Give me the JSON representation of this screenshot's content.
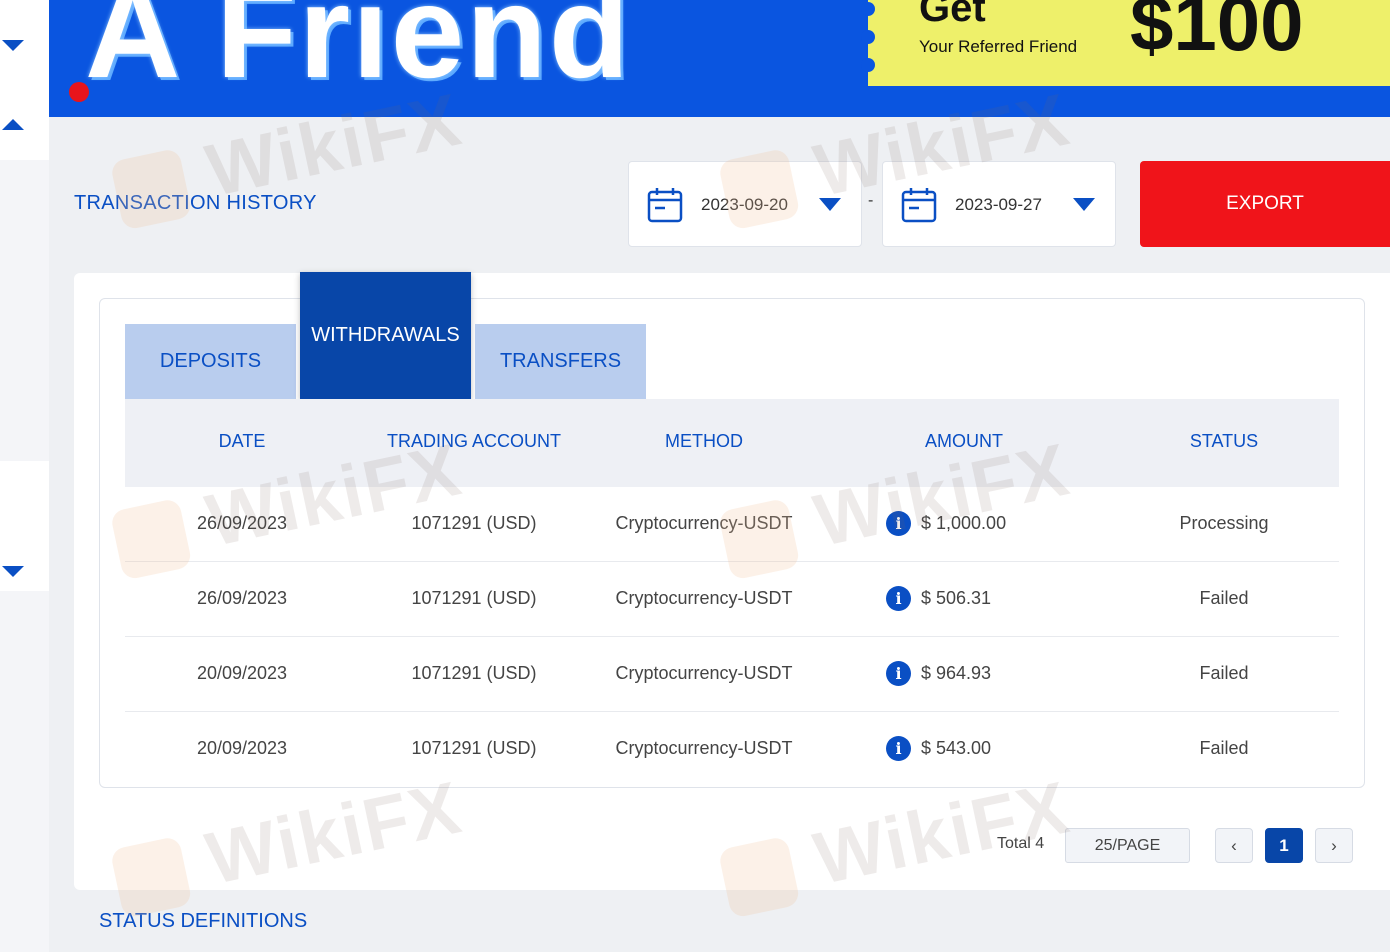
{
  "banner": {
    "title": "A Friend",
    "promo_get": "Get",
    "promo_sub": "Your Referred Friend",
    "promo_amount": "$100"
  },
  "page": {
    "title": "TRANSACTION HISTORY",
    "date_from": "2023-09-20",
    "date_separator": "-",
    "date_to": "2023-09-27",
    "export_label": "EXPORT"
  },
  "tabs": [
    {
      "label": "DEPOSITS",
      "active": false
    },
    {
      "label": "WITHDRAWALS",
      "active": true
    },
    {
      "label": "TRANSFERS",
      "active": false
    }
  ],
  "table": {
    "headers": [
      "DATE",
      "TRADING ACCOUNT",
      "METHOD",
      "AMOUNT",
      "STATUS"
    ],
    "rows": [
      {
        "date": "26/09/2023",
        "account": "1071291 (USD)",
        "method": "Cryptocurrency-USDT",
        "amount": "$ 1,000.00",
        "status": "Processing"
      },
      {
        "date": "26/09/2023",
        "account": "1071291 (USD)",
        "method": "Cryptocurrency-USDT",
        "amount": "$ 506.31",
        "status": "Failed"
      },
      {
        "date": "20/09/2023",
        "account": "1071291 (USD)",
        "method": "Cryptocurrency-USDT",
        "amount": "$ 964.93",
        "status": "Failed"
      },
      {
        "date": "20/09/2023",
        "account": "1071291 (USD)",
        "method": "Cryptocurrency-USDT",
        "amount": "$ 543.00",
        "status": "Failed"
      }
    ]
  },
  "pagination": {
    "total": "Total 4",
    "per_page": "25/PAGE",
    "prev": "‹",
    "current": "1",
    "next": "›"
  },
  "status_definitions": "STATUS DEFINITIONS",
  "watermark": "WikiFX",
  "colors": {
    "brand_blue": "#0a4fc4",
    "tab_active": "#0846a8",
    "export_red": "#f0141a",
    "promo_yellow": "#eef06a"
  }
}
